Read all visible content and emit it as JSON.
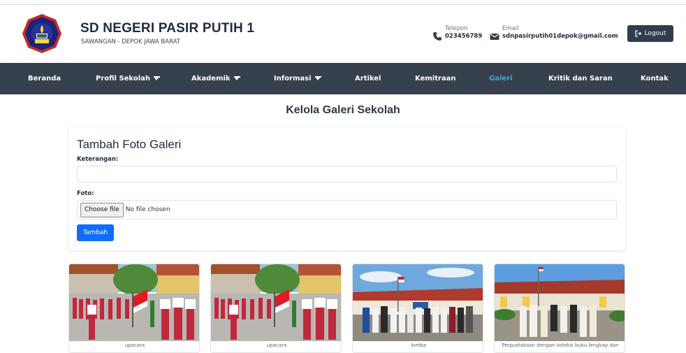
{
  "header": {
    "school_name": "SD NEGERI PASIR PUTIH 1",
    "school_location": "SAWANGAN - DEPOK JAWA BARAT",
    "phone_label": "Telepon",
    "phone_value": "023456789",
    "email_label": "Email",
    "email_value": "sdnpasirputih01depok@gmail.com",
    "logout_label": "Logout"
  },
  "nav": {
    "items": [
      {
        "label": "Beranda"
      },
      {
        "label": "Profil Sekolah"
      },
      {
        "label": "Akademik"
      },
      {
        "label": "Informasi"
      },
      {
        "label": "Artikel"
      },
      {
        "label": "Kemitraan"
      },
      {
        "label": "Galeri"
      },
      {
        "label": "Kritik dan Saran"
      },
      {
        "label": "Kontak"
      }
    ],
    "active": "Galeri",
    "active_color": "#3fa5e8",
    "bar_color": "#37414d"
  },
  "main": {
    "page_title": "Kelola Galeri Sekolah",
    "form": {
      "title": "Tambah Foto Galeri",
      "keterangan_label": "Keterangan:",
      "keterangan_value": "",
      "foto_label": "Foto:",
      "file_button": "Choose file",
      "file_status": "No file chosen",
      "submit_label": "Tambah",
      "submit_color": "#0d6efd"
    },
    "gallery": [
      {
        "caption": "upacara"
      },
      {
        "caption": "upacara"
      },
      {
        "caption": "lomba"
      },
      {
        "caption": "Perpustakaan dengan koleksi buku lengkap dan"
      }
    ]
  }
}
